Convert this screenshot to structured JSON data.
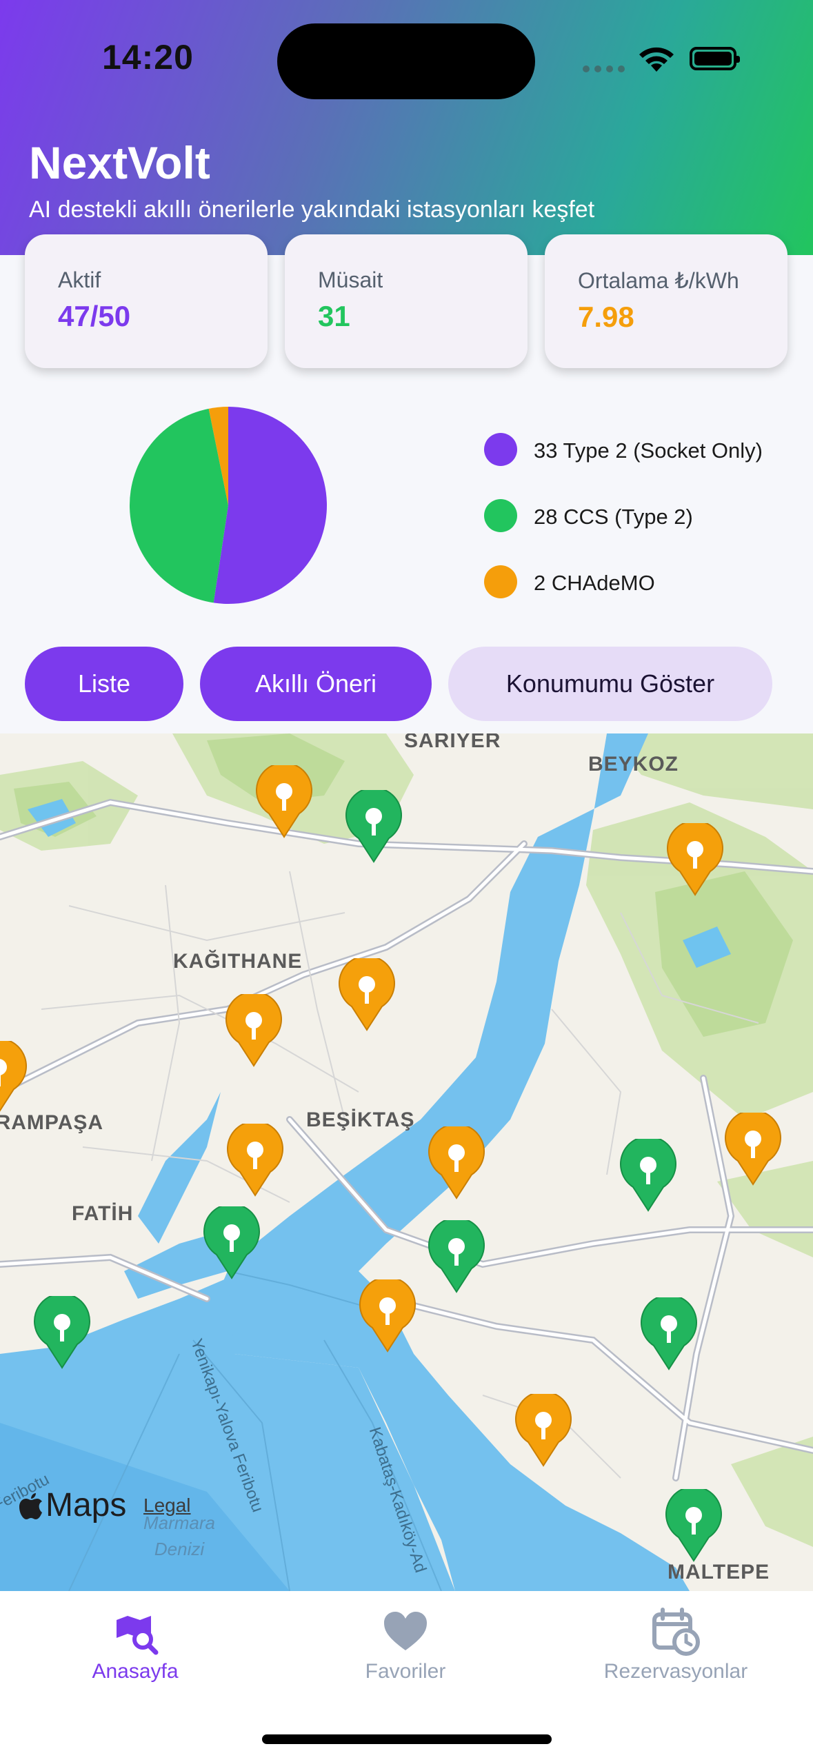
{
  "status_bar": {
    "time": "14:20"
  },
  "header": {
    "title": "NextVolt",
    "subtitle": "AI destekli akıllı önerilerle yakındaki istasyonları keşfet"
  },
  "stats": [
    {
      "label": "Aktif",
      "value": "47/50",
      "color": "#7c3aed"
    },
    {
      "label": "Müsait",
      "value": "31",
      "color": "#22c55e"
    },
    {
      "label": "Ortalama ₺/kWh",
      "value": "7.98",
      "color": "#f59e0b"
    }
  ],
  "connector_chart": {
    "type": "pie",
    "legend": [
      {
        "label": "33 Type 2 (Socket Only)",
        "value": 33,
        "color": "#7c3aed"
      },
      {
        "label": "28 CCS (Type 2)",
        "value": 28,
        "color": "#22c55e"
      },
      {
        "label": "2 CHAdeMO",
        "value": 2,
        "color": "#f59e0b"
      }
    ]
  },
  "actions": {
    "list": "Liste",
    "smart": "Akıllı Öneri",
    "location": "Konumumu Göster"
  },
  "map": {
    "districts": [
      "SARIYER",
      "BEYKOZ",
      "KAĞITHANE",
      "BAYRAMPAŞA",
      "BEŞİKTAŞ",
      "FATİH",
      "MALTEPE"
    ],
    "ferry_labels": [
      "Yenikapı-Yalova Feribotu",
      "Kabataş-Kadıköy-Ad",
      "Bostanlı-Yalova Feribotu"
    ],
    "sea_label": "Marmara Denizi",
    "attribution": "Maps",
    "legal": "Legal",
    "pin_colors": {
      "available": "#22b55e",
      "busy": "#f5a00b"
    }
  },
  "tabbar": [
    {
      "label": "Anasayfa",
      "active": true
    },
    {
      "label": "Favoriler",
      "active": false
    },
    {
      "label": "Rezervasyonlar",
      "active": false
    }
  ]
}
